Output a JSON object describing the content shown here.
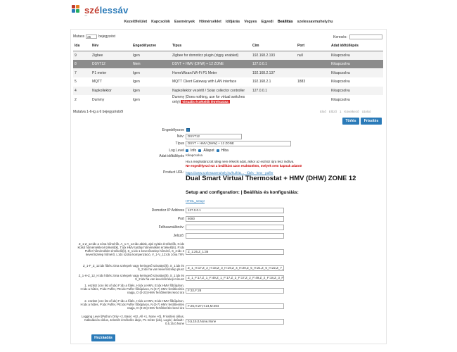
{
  "brand": {
    "name_a": "szé",
    "name_b": "lessáv",
    "sub": "net"
  },
  "nav": [
    "Kezelőfelület",
    "Kapcsolók",
    "Események",
    "Hőmérséklet",
    "Időjárás",
    "Vegyes",
    "Egyedi",
    "Beállítás",
    "szelessavmuhely.hu"
  ],
  "list": {
    "show_label": "Mutass",
    "page_size": "25",
    "entries_label": "bejegyzést",
    "search_label": "Keresés:",
    "columns": [
      "Ida",
      "Név",
      "Engedélyezve",
      "Típus",
      "Cím",
      "Port",
      "Adat időtúllépés"
    ],
    "rows": [
      {
        "id": "9",
        "name": "Zigbee",
        "enabled": "Igen",
        "type": "Zigbee for domoticz plugin (zigpy enabled)",
        "address": "192.168.2.193",
        "port": "null",
        "timeout": "Kikapcsolva"
      },
      {
        "id": "8",
        "name": "DSVT12",
        "enabled": "Nem",
        "type": "DSVT + HMV (DHW) + 12 ZONE",
        "address": "127.0.0.1",
        "port": "",
        "timeout": "Kikapcsolva"
      },
      {
        "id": "7",
        "name": "P1 meter",
        "enabled": "Igen",
        "type": "HomeWizard Wi-Fi P1 Meter",
        "address": "192.168.2.137",
        "port": "",
        "timeout": "Kikapcsolva"
      },
      {
        "id": "5",
        "name": "MQTT",
        "enabled": "Igen",
        "type": "MQTT Client Gateway with LAN interface",
        "address": "192.168.2.1",
        "port": "1883",
        "timeout": "Kikapcsolva"
      },
      {
        "id": "4",
        "name": "Napkollektor",
        "enabled": "Igen",
        "type": "Napkollektor vezérlő / Solar collector controller",
        "address": "127.0.0.1",
        "port": "",
        "timeout": "Kikapcsolva"
      },
      {
        "id": "2",
        "name": "Dummy",
        "enabled": "Igen",
        "type": "Dummy (Does nothing, use for virtual switches only)",
        "type_badge": "Virtuális érzékelők létrehozása",
        "address": "",
        "port": "",
        "timeout": "Kikapcsolva"
      }
    ],
    "info": "Mutatva 1-6-ig a 6 bejegyzésből",
    "pager": [
      "Első",
      "Előző",
      "1",
      "Következő",
      "Utolsó"
    ]
  },
  "actions": {
    "delete": "Törlés",
    "update": "Frissítés"
  },
  "form": {
    "enabled_label": "Engedélyezve",
    "name_label": "Név:",
    "name_value": "DSVT12",
    "type_label": "Típus",
    "type_value": "DSVT + HMV (DHW) + 12 ZONE",
    "log_label": "Log Level",
    "log_options": [
      "Info",
      "Állapot",
      "Hiba"
    ],
    "timeout_label": "Adat időtúllépés",
    "timeout_value": "Kikapcsolva",
    "timeout_hint": "Ha a meghatározott ideig nem érkezik adat, akkor az eszköz újra lesz indítva.",
    "timeout_warn": "Ne engedélyezd ezt a beállítást azon eszközökön, melyek nem kapnak adatot!",
    "product_label": "Product URL:",
    "product_link": "https://www.szelessavmuhely.hu/hu/fritz... - fűtés - hmv - puffer",
    "product_title": "Dual Smart Virtual Thermostat + HMV (DHW) ZONE 12",
    "setup_title": "Setup and configuration: | Beállítás és konfigurálás:",
    "html_link": "HTML_setup!",
    "fields": [
      {
        "label": "Domoticz IP Address",
        "value": "127.0.0.1"
      },
      {
        "label": "Port",
        "value": "8080"
      },
      {
        "label": "Felhasználónév:",
        "value": ""
      },
      {
        "label": "Jelszó:",
        "value": ""
      },
      {
        "label": "Z_1-Z_12:idx a zóna hőmérők, A_1-A_12:idx ablak, ajtó nyitás érzékelők, K:idx Külső hőmérséklet érzékelő(k), T:idx HMV tartály hőmérséklet érzékelő(k), P:idx Puffer hőmérséklet érzékelő(k), S_1:idx 1 keverőszelep hőmérő, S_2:idx 2 keverőszelep hőmérő, L:idx szoba kompenzáció, V_1-V_12:idx zóna TRV",
        "value": "Z_1:26,Z_1:36"
      },
      {
        "label": "Z_1-F_Z_12:idx fűtés zóna szelepek vagy keringető szivattyú(k), S_1:idx és S_2:idx ha van keverőszelep plusz",
        "value": "Z_1_H:17,Z_2_H:18,Z_3_H:19,Z_4_H:20,Z_5_H:21,Z_6_H:22,Z_7_H:23"
      },
      {
        "label": "Z_1-H-Z_12_H:idx hűtés zóna szelepek vagy keringető szivattyú(k), S_1:idx és S_2:idx ha van keverőszelep mínusz",
        "value": "Z_1_F:17,Z_1_F:49,Z_1_F:17,Z_2_F:17,Z_2_F:49,Z_2_F:18,Z_3_F"
      },
      {
        "label": "1. eszköz (csv list of idx) F:idx a fűtés, H:idx a HMV, E:idx HMV főbűpáron, H:idx a hűtés, P:idx Puffer, PE:idx Puffer főbűpáron, N (0-7) HMV fertőtlenítés napja, O (0-23) HMV fertőtlenítés kezd óra",
        "value": "F:32,F:28"
      },
      {
        "label": "2. eszköz (csv list of idx) F:idx a fűtés, H:idx a HMV, E:idx HMV főbűpáron, H:idx a hűtés, P:idx Puffer, PE:idx Puffer főbűpáron, N (0-7) HMV fertőtlenítés napja, O (0-23) HMV fertőtlenítés kezd óra",
        "value": "F:25,H:27,H:24,M:494"
      },
      {
        "label": "Logging Level (Python Only +2, Basic +62, All +1, None +0), Frissítési ciklus, Kalkulációs ciklus, Jelenlét érzékelés ideje, P1 méter (idx), Login | default+ 0,5,15,0,None",
        "value": "0,5,15,0,None,None"
      }
    ],
    "save": "Hozzáadás"
  },
  "colors": {
    "accent": "#2a7ab8",
    "selected_row": "#8c8c8c",
    "warning": "#d92b2b"
  }
}
